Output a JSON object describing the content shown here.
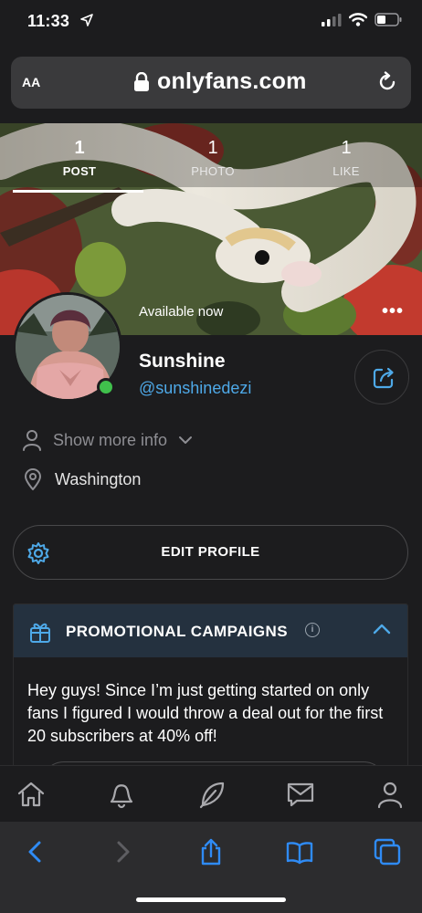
{
  "status_bar": {
    "time": "11:33"
  },
  "address_bar": {
    "text_size_label": "AA",
    "url": "onlyfans.com"
  },
  "cover": {
    "stats": [
      {
        "count": "1",
        "label": "POST",
        "active": true
      },
      {
        "count": "1",
        "label": "PHOTO",
        "active": false
      },
      {
        "count": "1",
        "label": "LIKE",
        "active": false
      }
    ],
    "availability": "Available now",
    "more_label": "•••"
  },
  "profile": {
    "name": "Sunshine",
    "handle": "@sunshinedezi",
    "show_more_label": "Show more info",
    "location": "Washington",
    "online": true
  },
  "edit_profile": {
    "label": "EDIT PROFILE"
  },
  "promo": {
    "title": "PROMOTIONAL CAMPAIGNS",
    "info_glyph": "i",
    "body": "Hey guys! Since I’m just getting started on only fans I figured I would throw a deal out for the first 20 subscribers at 40% off!"
  },
  "app_nav": [
    "home-icon",
    "bell-icon",
    "feather-icon",
    "message-icon",
    "user-icon"
  ],
  "safari_toolbar": [
    "back-icon",
    "forward-icon",
    "share-icon",
    "bookmarks-icon",
    "tabs-icon"
  ],
  "colors": {
    "accent": "#4ea9e8",
    "online": "#40c04c",
    "background": "#1c1c1e",
    "promo_header": "#24313f"
  }
}
